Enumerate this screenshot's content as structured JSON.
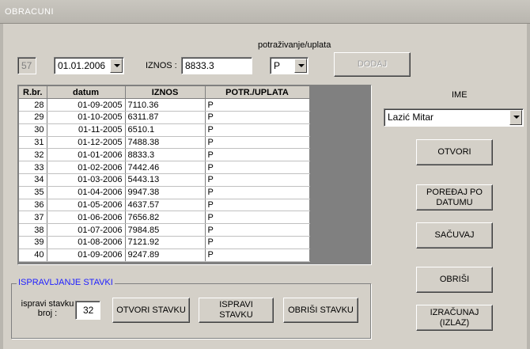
{
  "window": {
    "title": "OBRACUNI"
  },
  "form": {
    "id_value": "57",
    "date_value": "01.01.2006",
    "amount_label": "IZNOS :",
    "amount_value": "8833.3",
    "type_caption": "potraživanje/uplata",
    "type_value": "P",
    "add_button": "DODAJ"
  },
  "table": {
    "headers": [
      "R.br.",
      "datum",
      "IZNOS",
      "POTR./UPLATA"
    ],
    "rows": [
      [
        "28",
        "01-09-2005",
        "7110.36",
        "P"
      ],
      [
        "29",
        "01-10-2005",
        "6311.87",
        "P"
      ],
      [
        "30",
        "01-11-2005",
        "6510.1",
        "P"
      ],
      [
        "31",
        "01-12-2005",
        "7488.38",
        "P"
      ],
      [
        "32",
        "01-01-2006",
        "8833.3",
        "P"
      ],
      [
        "33",
        "01-02-2006",
        "7442.46",
        "P"
      ],
      [
        "34",
        "01-03-2006",
        "5443.13",
        "P"
      ],
      [
        "35",
        "01-04-2006",
        "9947.38",
        "P"
      ],
      [
        "36",
        "01-05-2006",
        "4637.57",
        "P"
      ],
      [
        "37",
        "01-06-2006",
        "7656.82",
        "P"
      ],
      [
        "38",
        "01-07-2006",
        "7984.85",
        "P"
      ],
      [
        "39",
        "01-08-2006",
        "7121.92",
        "P"
      ],
      [
        "40",
        "01-09-2006",
        "9247.89",
        "P"
      ]
    ]
  },
  "side": {
    "name_label": "IME",
    "name_value": "Lazić Mitar",
    "open_button": "OTVORI",
    "sort_button": "POREĐAJ PO DATUMU",
    "save_button": "SAČUVAJ",
    "delete_button": "OBRIŠI",
    "calc_button": "IZRAČUNAJ (IZLAZ)"
  },
  "edit_group": {
    "title": "ISPRAVLJANJE STAVKI",
    "item_label": "ispravi stavku broj :",
    "item_value": "32",
    "open_item_button": "OTVORI STAVKU",
    "edit_item_button": "ISPRAVI STAVKU",
    "delete_item_button": "OBRIŠI STAVKU"
  },
  "colors": {
    "face": "#d4d0c8",
    "group_title": "#2020ff"
  }
}
